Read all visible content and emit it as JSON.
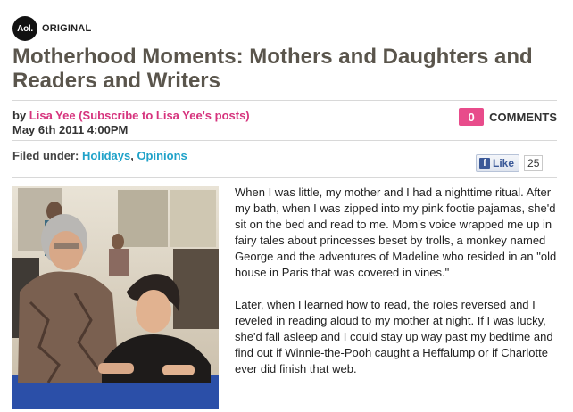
{
  "brand": {
    "logo_text": "Aol.",
    "label": "ORIGINAL"
  },
  "article": {
    "title": "Motherhood Moments: Mothers and Daughters and Readers and Writers",
    "byline_prefix": "by",
    "author": "Lisa Yee (Subscribe to Lisa Yee's posts)",
    "date": "May 6th 2011 4:00PM",
    "filed_prefix": "Filed under:",
    "categories": [
      "Holidays",
      "Opinions"
    ],
    "paragraphs": [
      "When I was little, my mother and I had a nighttime ritual. After my bath, when I was zipped into my pink footie pajamas, she'd sit on the bed and read to me. Mom's voice wrapped me up in fairy tales about princesses beset by trolls, a monkey named George and the adventures of Madeline who resided in an \"old house in Paris that was covered in vines.\"",
      "Later, when I learned how to read, the roles reversed and I reveled in reading aloud to my mother at night. If I was lucky, she'd fall asleep and I could stay up way past my bedtime and find out if Winnie-the-Pooh caught a Heffalump or if Charlotte ever did finish that web."
    ]
  },
  "comments": {
    "count": "0",
    "label": "COMMENTS"
  },
  "like": {
    "icon": "facebook-icon",
    "label": "Like",
    "count": "25"
  },
  "colors": {
    "author": "#d6337d",
    "link": "#1fa2c9",
    "comment_badge": "#e84c8b",
    "title": "#5a554c"
  }
}
